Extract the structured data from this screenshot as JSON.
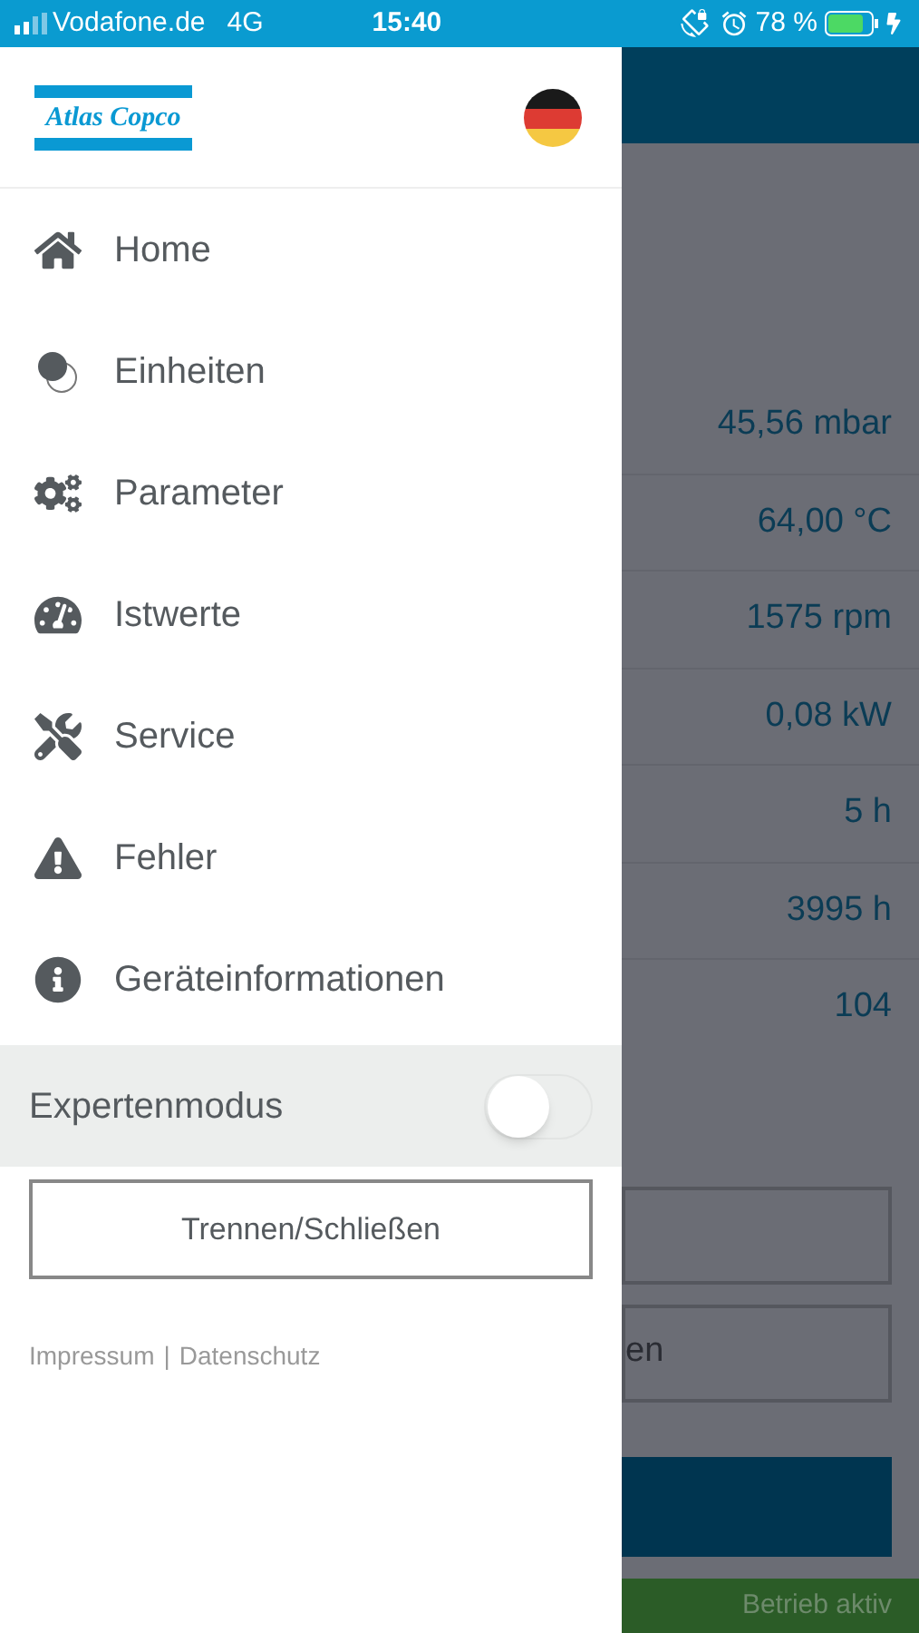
{
  "status_bar": {
    "carrier": "Vodafone.de",
    "network": "4G",
    "time": "15:40",
    "battery": "78 %"
  },
  "drawer": {
    "logo": "Atlas Copco",
    "items": [
      {
        "label": "Home"
      },
      {
        "label": "Einheiten"
      },
      {
        "label": "Parameter"
      },
      {
        "label": "Istwerte"
      },
      {
        "label": "Service"
      },
      {
        "label": "Fehler"
      },
      {
        "label": "Geräteinformationen"
      }
    ],
    "expert_mode": {
      "label": "Expertenmodus",
      "on": false
    },
    "disconnect_button": "Trennen/Schließen",
    "footer_links": [
      "Impressum",
      "Datenschutz"
    ],
    "footer_separator": "|"
  },
  "background": {
    "values": [
      "45,56 mbar",
      "64,00 °C",
      "1575 rpm",
      "0,08 kW",
      "5 h",
      "3995 h",
      "104"
    ],
    "button_2_fragment": "en",
    "status": "Betrieb aktiv"
  }
}
